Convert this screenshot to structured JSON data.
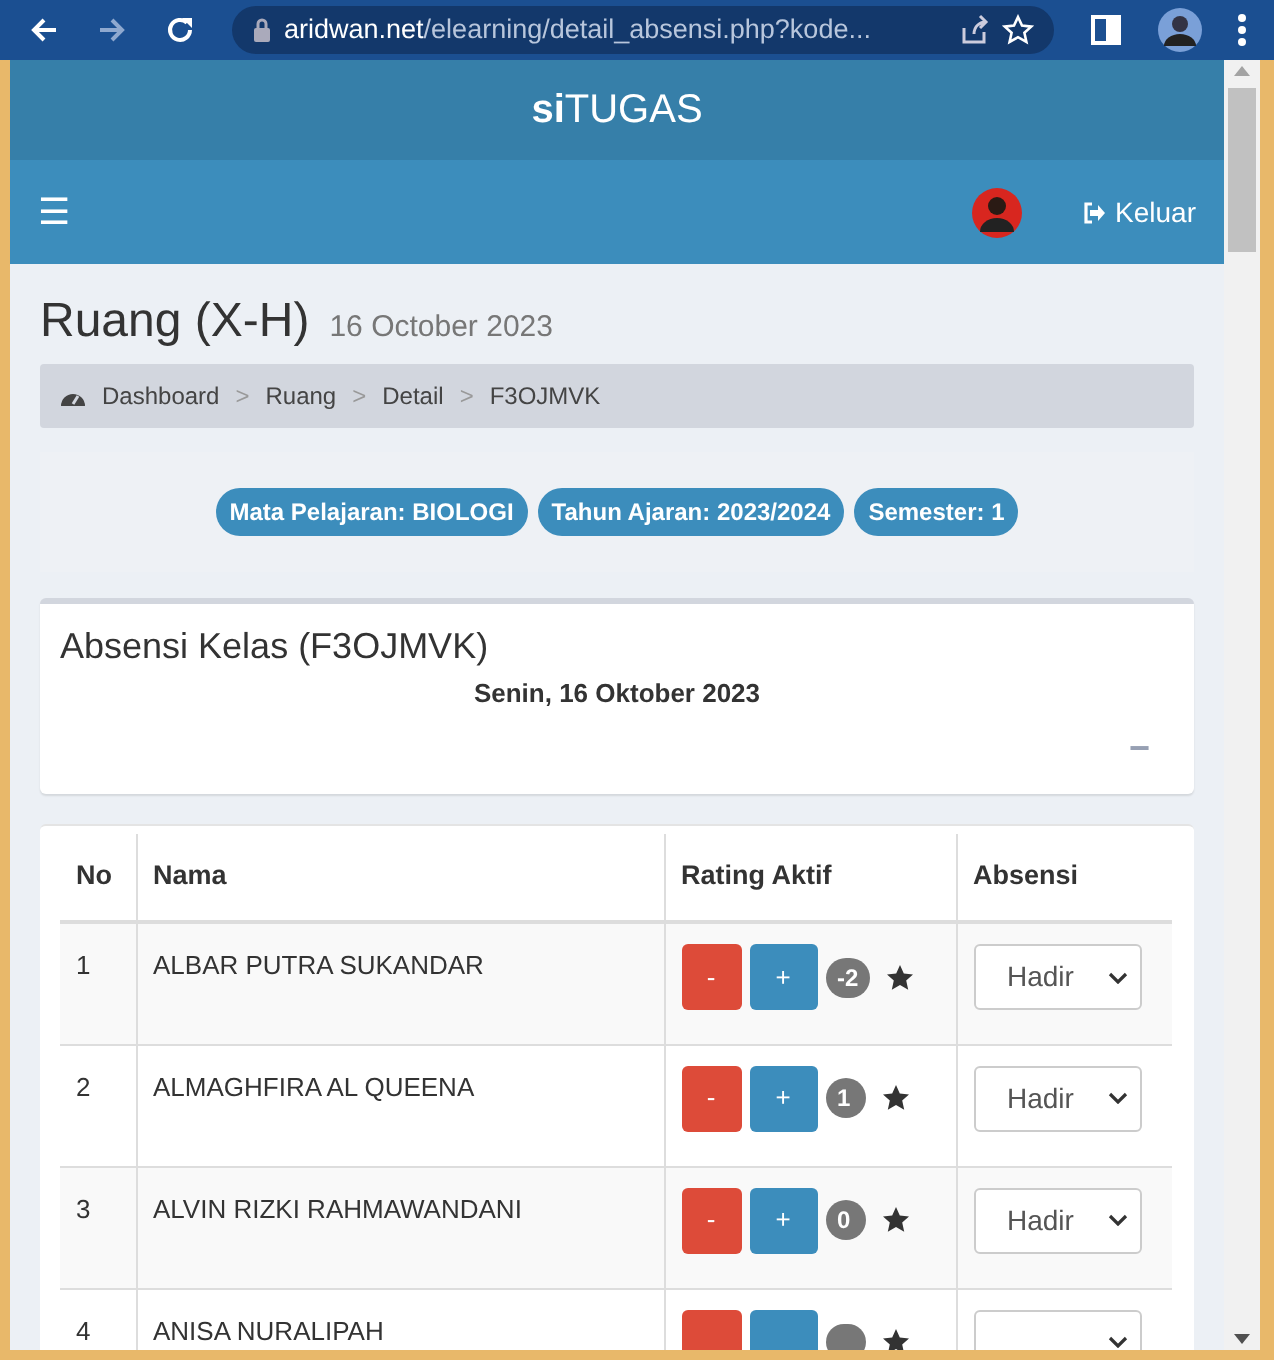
{
  "browser": {
    "url_host": "aridwan.net",
    "url_path": "/elearning/detail_absensi.php?kode..."
  },
  "header": {
    "brand_bold": "si",
    "brand_rest": "TUGAS"
  },
  "navbar": {
    "menu_glyph": "☰",
    "logout": "Keluar"
  },
  "page": {
    "title": "Ruang (X-H)",
    "subtitle": "16 October 2023"
  },
  "breadcrumb": [
    "Dashboard",
    "Ruang",
    "Detail",
    "F3OJMVK"
  ],
  "breadcrumb_separator": ">",
  "badges": [
    "Mata Pelajaran: BIOLOGI",
    "Tahun Ajaran: 2023/2024",
    "Semester: 1"
  ],
  "attendance_card": {
    "title": "Absensi Kelas (F3OJMVK)",
    "date": "Senin, 16 Oktober 2023",
    "collapse_glyph": "−"
  },
  "table": {
    "columns": [
      "No",
      "Nama",
      "Rating Aktif",
      "Absensi"
    ],
    "rows": [
      {
        "no": "1",
        "name": "ALBAR PUTRA SUKANDAR",
        "minus": "-",
        "plus": "+",
        "rating": "-2",
        "absensi": "Hadir"
      },
      {
        "no": "2",
        "name": "ALMAGHFIRA AL QUEENA",
        "minus": "-",
        "plus": "+",
        "rating": "1",
        "absensi": "Hadir"
      },
      {
        "no": "3",
        "name": "ALVIN RIZKI RAHMAWANDANI",
        "minus": "-",
        "plus": "+",
        "rating": "0",
        "absensi": "Hadir"
      },
      {
        "no": "4",
        "name": "ANISA NURALIPAH"
      }
    ]
  }
}
